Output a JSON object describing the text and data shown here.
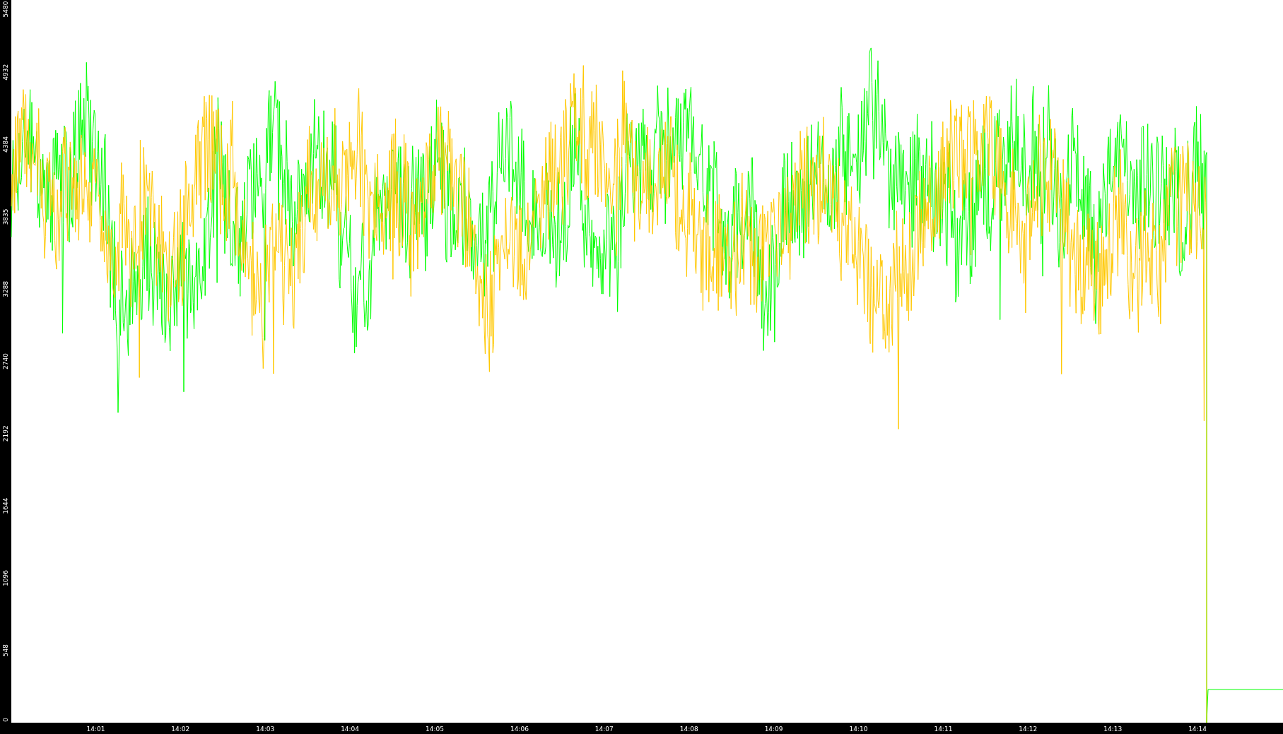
{
  "chart": {
    "y_axis": {
      "ticks": [
        "0",
        "548",
        "1096",
        "1644",
        "2192",
        "2740",
        "3288",
        "3835",
        "4384",
        "4932",
        "5480"
      ]
    },
    "x_axis": {
      "ticks": [
        "14:01",
        "14:02",
        "14:03",
        "14:04",
        "14:05",
        "14:06",
        "14:07",
        "14:08",
        "14:09",
        "14:10",
        "14:11",
        "14:12",
        "14:13",
        "14:14"
      ]
    },
    "traces": [
      {
        "color": "#00ff00"
      },
      {
        "color": "#ffc800"
      }
    ]
  }
}
